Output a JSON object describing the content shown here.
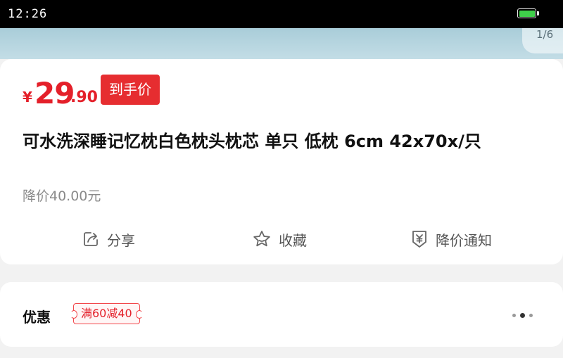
{
  "status_bar": {
    "time": "12:26"
  },
  "gallery": {
    "page_indicator": "1/6"
  },
  "price": {
    "symbol": "¥",
    "integer": "29",
    "decimal": ".90",
    "badge": "到手价"
  },
  "product": {
    "title": "可水洗深睡记忆枕白色枕头枕芯 单只 低枕 6cm 42x70x/只",
    "price_drop_note": "降价40.00元"
  },
  "actions": [
    {
      "label": "分享",
      "icon": "share-icon"
    },
    {
      "label": "收藏",
      "icon": "star-icon"
    },
    {
      "label": "降价通知",
      "icon": "price-alert-icon"
    }
  ],
  "promo": {
    "label": "优惠",
    "coupon": "满60减40"
  },
  "colors": {
    "accent": "#e4202a",
    "battery": "#3fcf4a"
  }
}
